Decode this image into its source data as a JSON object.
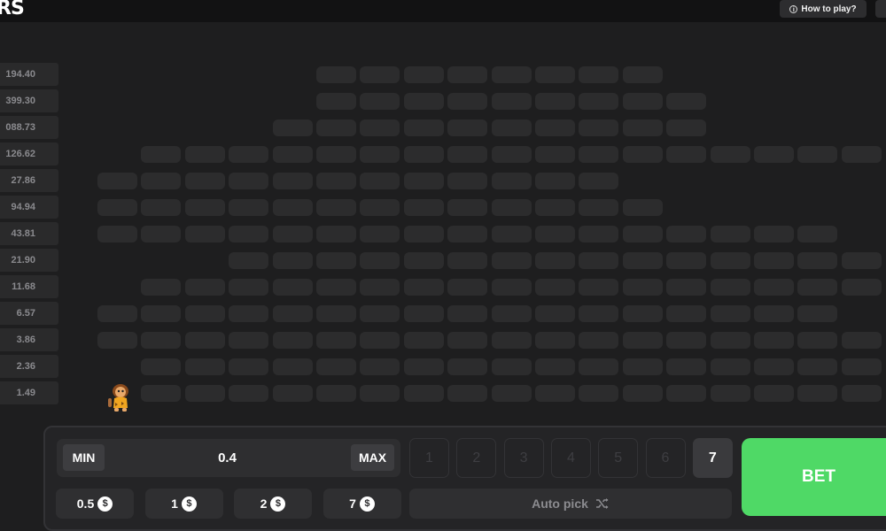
{
  "header": {
    "logo_text": "RS",
    "how_to_play_label": "How to play?",
    "info_icon_glyph": "i"
  },
  "multipliers": [
    "194.40",
    "399.30",
    "088.73",
    "126.62",
    "27.86",
    "94.94",
    "43.81",
    "21.90",
    "11.68",
    "6.57",
    "3.86",
    "2.36",
    "1.49"
  ],
  "grid_rows": [
    {
      "active": [
        5,
        6,
        7,
        8,
        9,
        10,
        11,
        12
      ]
    },
    {
      "active": [
        5,
        6,
        7,
        8,
        9,
        10,
        11,
        12,
        13
      ]
    },
    {
      "active": [
        4,
        5,
        6,
        7,
        8,
        9,
        10,
        11,
        12,
        13
      ]
    },
    {
      "active": [
        1,
        2,
        3,
        4,
        5,
        6,
        7,
        8,
        9,
        10,
        11,
        12,
        13,
        14,
        15,
        16,
        17
      ]
    },
    {
      "active": [
        0,
        1,
        2,
        3,
        4,
        5,
        6,
        7,
        8,
        9,
        10,
        11
      ]
    },
    {
      "active": [
        0,
        1,
        2,
        3,
        4,
        5,
        6,
        7,
        8,
        9,
        10,
        11,
        12
      ]
    },
    {
      "active": [
        0,
        1,
        2,
        3,
        4,
        5,
        6,
        7,
        8,
        9,
        10,
        11,
        12,
        13,
        14,
        15,
        16
      ]
    },
    {
      "active": [
        3,
        4,
        5,
        6,
        7,
        8,
        9,
        10,
        11,
        12,
        13,
        14,
        15,
        16,
        17
      ]
    },
    {
      "active": [
        1,
        2,
        3,
        4,
        5,
        6,
        7,
        8,
        9,
        10,
        11,
        12,
        13,
        14,
        15,
        16,
        17
      ]
    },
    {
      "active": [
        0,
        1,
        2,
        3,
        4,
        5,
        6,
        7,
        8,
        9,
        10,
        11,
        12,
        13,
        14,
        15,
        16
      ]
    },
    {
      "active": [
        0,
        1,
        2,
        3,
        4,
        5,
        6,
        7,
        8,
        9,
        10,
        11,
        12,
        13,
        14,
        15,
        16,
        17
      ]
    },
    {
      "active": [
        1,
        2,
        3,
        4,
        5,
        6,
        7,
        8,
        9,
        10,
        11,
        12,
        13,
        14,
        15,
        16,
        17
      ]
    },
    {
      "active": [
        0,
        1,
        2,
        3,
        4,
        5,
        6,
        7,
        8,
        9,
        10,
        11,
        12,
        13,
        14,
        15,
        16,
        17
      ]
    }
  ],
  "player_position": {
    "row": 12,
    "col": 0
  },
  "panel": {
    "min_label": "MIN",
    "max_label": "MAX",
    "bet_amount": "0.4",
    "numbers": [
      "1",
      "2",
      "3",
      "4",
      "5",
      "6",
      "7"
    ],
    "selected_number": "7",
    "quick_bets": [
      "0.5",
      "1",
      "2",
      "7"
    ],
    "currency_glyph": "$",
    "auto_pick_label": "Auto pick",
    "shuffle_icon": "shuffle-icon",
    "bet_label": "BET"
  },
  "colors": {
    "bet_green": "#4fd966",
    "cell": "#2c2c2d",
    "background": "#1e1e1f"
  }
}
